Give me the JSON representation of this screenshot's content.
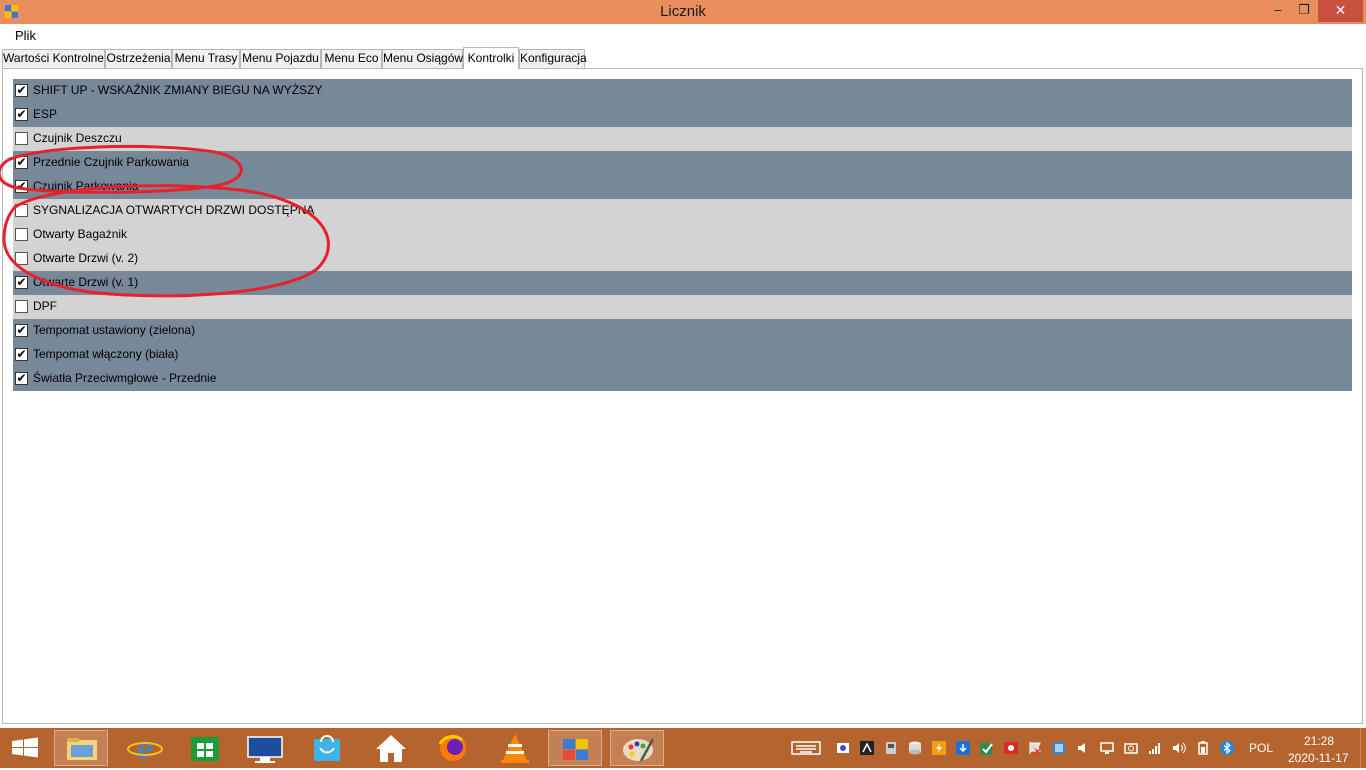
{
  "window": {
    "title": "Licznik",
    "minimize": "–",
    "maximize": "❒",
    "close": "✕"
  },
  "menu": {
    "file": "Plik"
  },
  "tabs": [
    {
      "label": "Wartości Kontrolne",
      "active": false
    },
    {
      "label": "Ostrzeżenia",
      "active": false
    },
    {
      "label": "Menu Trasy",
      "active": false
    },
    {
      "label": "Menu Pojazdu",
      "active": false
    },
    {
      "label": "Menu Eco",
      "active": false
    },
    {
      "label": "Menu Osiągów",
      "active": false
    },
    {
      "label": "Kontrolki",
      "active": true
    },
    {
      "label": "Konfiguracja",
      "active": false
    }
  ],
  "controls": [
    {
      "label": "SHIFT UP - WSKAŹNIK ZMIANY BIEGU NA WYŻSZY",
      "checked": true
    },
    {
      "label": "ESP",
      "checked": true
    },
    {
      "label": "Czujnik Deszczu",
      "checked": false
    },
    {
      "label": "Przednie Czujnik Parkowania",
      "checked": true
    },
    {
      "label": "Czujnik Parkowania",
      "checked": true
    },
    {
      "label": "SYGNALIZACJA OTWARTYCH DRZWI DOSTĘPNA",
      "checked": false
    },
    {
      "label": "Otwarty Bagażnik",
      "checked": false
    },
    {
      "label": "Otwarte Drzwi (v. 2)",
      "checked": false
    },
    {
      "label": "Otwarte Drzwi (v. 1)",
      "checked": true
    },
    {
      "label": "DPF",
      "checked": false
    },
    {
      "label": "Tempomat ustawiony (zielona)",
      "checked": true
    },
    {
      "label": "Tempomat włączony (biała)",
      "checked": true
    },
    {
      "label": "Światła Przeciwmgłowe - Przednie",
      "checked": true
    }
  ],
  "colors": {
    "checked_row": "#778899",
    "unchecked_row": "#d3d3d3",
    "titlebar": "#e98e5d",
    "taskbar": "#b5642e",
    "annotation": "#e8202a"
  },
  "taskbar": {
    "apps": [
      "windows-start-icon",
      "file-explorer-icon",
      "internet-explorer-icon",
      "windows-store-icon",
      "lenovo-icon",
      "store-bag-icon",
      "home-icon",
      "firefox-icon",
      "vlc-icon",
      "licznik-app-icon",
      "paint-icon"
    ],
    "language": "POL",
    "time": "21:28",
    "date": "2020-11-17"
  }
}
